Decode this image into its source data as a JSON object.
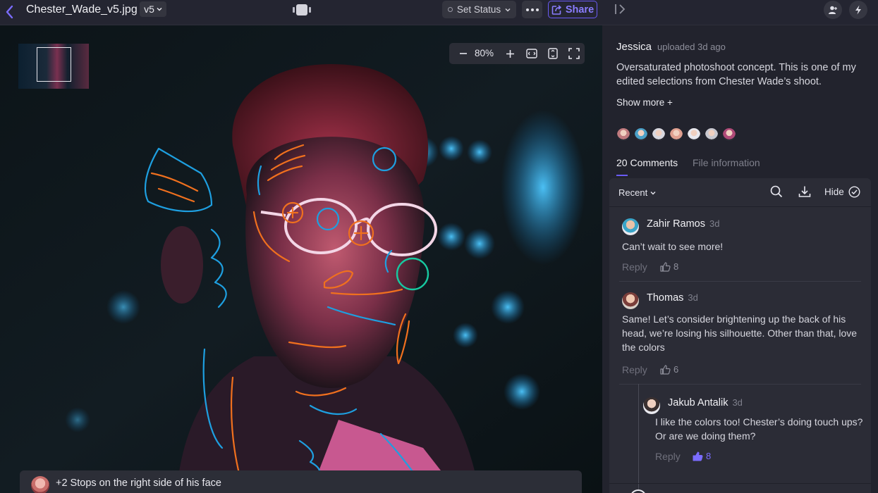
{
  "header": {
    "file_name": "Chester_Wade_v5.jpg",
    "version": "v5",
    "status_label": "Set Status",
    "share_label": "Share"
  },
  "viewer": {
    "zoom_level": "80%",
    "annotation_text": "+2 Stops on the right side of his face"
  },
  "panel": {
    "uploader": "Jessica",
    "upload_time": "uploaded 3d ago",
    "description": "Oversaturated photoshoot concept. This is one of my edited selections from Chester Wade’s shoot.",
    "show_more": "Show more +",
    "viewer_avatars": [
      "#c07a7e",
      "#4aa0c8",
      "#d8d8e0",
      "#e0a090",
      "#e8e8ee",
      "#c8c8d0",
      "#b04a78"
    ],
    "tabs": [
      {
        "label": "20 Comments",
        "active": true
      },
      {
        "label": "File information",
        "active": false
      }
    ]
  },
  "comments_panel": {
    "sort_label": "Recent",
    "hide_label": "Hide",
    "comments": [
      {
        "author": "Zahir Ramos",
        "time": "3d",
        "body": "Can’t wait to see more!",
        "reply_label": "Reply",
        "likes": "8"
      },
      {
        "author": "Thomas",
        "time": "3d",
        "body": "Same! Let’s consider brightening up the back of his head, we’re losing his silhouette. Other than that, love the colors",
        "reply_label": "Reply",
        "likes": "6"
      },
      {
        "author": "Jakub Antalik",
        "time": "3d",
        "body": "I like the colors too! Chester’s doing touch ups? Or are we doing them?",
        "reply_label": "Reply",
        "likes": "8"
      }
    ]
  },
  "colors": {
    "accent": "#6a5bf5",
    "markup_blue": "#1e9fe0",
    "markup_orange": "#f0701e",
    "markup_teal": "#17c9a0"
  }
}
